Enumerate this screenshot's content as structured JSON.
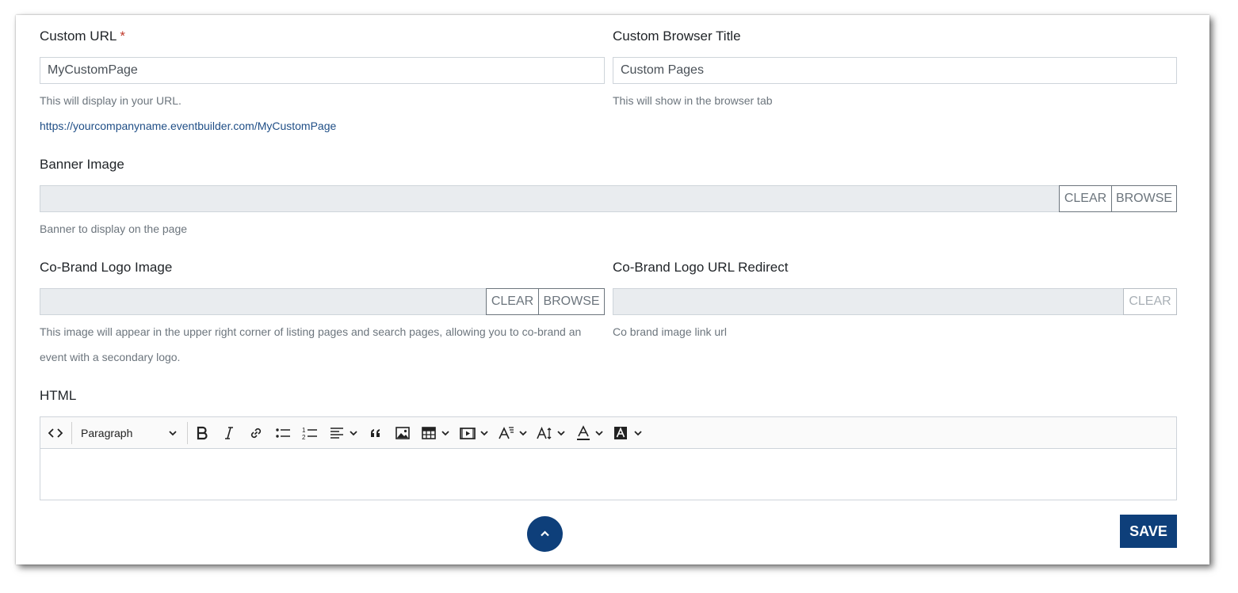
{
  "custom_url": {
    "label": "Custom URL",
    "required_mark": "*",
    "value": "MyCustomPage",
    "help": "This will display in your URL.",
    "preview_link": "https://yourcompanyname.eventbuilder.com/MyCustomPage"
  },
  "browser_title": {
    "label": "Custom Browser Title",
    "value": "Custom Pages",
    "help": "This will show in the browser tab"
  },
  "banner": {
    "label": "Banner Image",
    "value": "",
    "clear_label": "CLEAR",
    "browse_label": "BROWSE",
    "help": "Banner to display on the page"
  },
  "cobrand_logo": {
    "label": "Co-Brand Logo Image",
    "value": "",
    "clear_label": "CLEAR",
    "browse_label": "BROWSE",
    "help_line1": "This image will appear in the upper right corner of listing pages and search pages, allowing you to co-brand an",
    "help_line2": "event with a secondary logo."
  },
  "cobrand_url": {
    "label": "Co-Brand Logo URL Redirect",
    "value": "",
    "clear_label": "CLEAR",
    "help": "Co brand image link url"
  },
  "html_editor": {
    "label": "HTML",
    "block_format": "Paragraph",
    "content": "",
    "toolbar_icons": [
      "code-view-icon",
      "bold-icon",
      "italic-icon",
      "link-icon",
      "bullet-list-icon",
      "numbered-list-icon",
      "align-icon",
      "blockquote-icon",
      "image-icon",
      "table-icon",
      "media-icon",
      "font-family-icon",
      "font-size-icon",
      "text-color-icon",
      "highlight-color-icon"
    ]
  },
  "actions": {
    "save_label": "SAVE",
    "scroll_top_icon": "chevron-up-icon"
  },
  "colors": {
    "primary": "#0e3f7a",
    "required": "#c0392b",
    "link": "#1f4e86",
    "help_text": "#6c757d",
    "disabled_bg": "#e9ecef"
  }
}
